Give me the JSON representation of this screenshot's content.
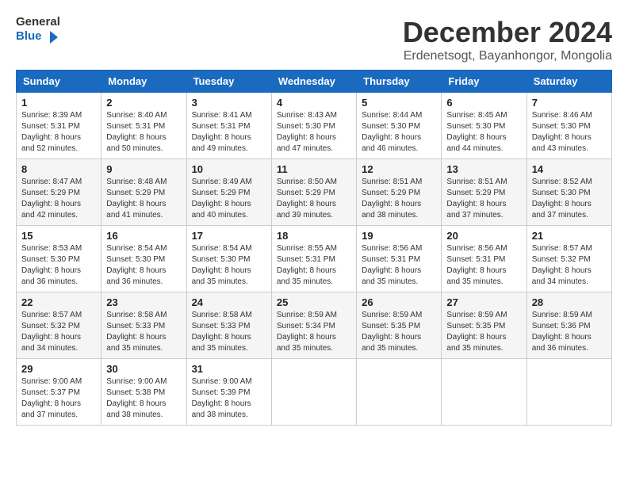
{
  "logo": {
    "line1": "General",
    "line2": "Blue"
  },
  "title": "December 2024",
  "subtitle": "Erdenetsogt, Bayanhongor, Mongolia",
  "header_days": [
    "Sunday",
    "Monday",
    "Tuesday",
    "Wednesday",
    "Thursday",
    "Friday",
    "Saturday"
  ],
  "weeks": [
    [
      {
        "day": "1",
        "sunrise": "Sunrise: 8:39 AM",
        "sunset": "Sunset: 5:31 PM",
        "daylight": "Daylight: 8 hours and 52 minutes."
      },
      {
        "day": "2",
        "sunrise": "Sunrise: 8:40 AM",
        "sunset": "Sunset: 5:31 PM",
        "daylight": "Daylight: 8 hours and 50 minutes."
      },
      {
        "day": "3",
        "sunrise": "Sunrise: 8:41 AM",
        "sunset": "Sunset: 5:31 PM",
        "daylight": "Daylight: 8 hours and 49 minutes."
      },
      {
        "day": "4",
        "sunrise": "Sunrise: 8:43 AM",
        "sunset": "Sunset: 5:30 PM",
        "daylight": "Daylight: 8 hours and 47 minutes."
      },
      {
        "day": "5",
        "sunrise": "Sunrise: 8:44 AM",
        "sunset": "Sunset: 5:30 PM",
        "daylight": "Daylight: 8 hours and 46 minutes."
      },
      {
        "day": "6",
        "sunrise": "Sunrise: 8:45 AM",
        "sunset": "Sunset: 5:30 PM",
        "daylight": "Daylight: 8 hours and 44 minutes."
      },
      {
        "day": "7",
        "sunrise": "Sunrise: 8:46 AM",
        "sunset": "Sunset: 5:30 PM",
        "daylight": "Daylight: 8 hours and 43 minutes."
      }
    ],
    [
      {
        "day": "8",
        "sunrise": "Sunrise: 8:47 AM",
        "sunset": "Sunset: 5:29 PM",
        "daylight": "Daylight: 8 hours and 42 minutes."
      },
      {
        "day": "9",
        "sunrise": "Sunrise: 8:48 AM",
        "sunset": "Sunset: 5:29 PM",
        "daylight": "Daylight: 8 hours and 41 minutes."
      },
      {
        "day": "10",
        "sunrise": "Sunrise: 8:49 AM",
        "sunset": "Sunset: 5:29 PM",
        "daylight": "Daylight: 8 hours and 40 minutes."
      },
      {
        "day": "11",
        "sunrise": "Sunrise: 8:50 AM",
        "sunset": "Sunset: 5:29 PM",
        "daylight": "Daylight: 8 hours and 39 minutes."
      },
      {
        "day": "12",
        "sunrise": "Sunrise: 8:51 AM",
        "sunset": "Sunset: 5:29 PM",
        "daylight": "Daylight: 8 hours and 38 minutes."
      },
      {
        "day": "13",
        "sunrise": "Sunrise: 8:51 AM",
        "sunset": "Sunset: 5:29 PM",
        "daylight": "Daylight: 8 hours and 37 minutes."
      },
      {
        "day": "14",
        "sunrise": "Sunrise: 8:52 AM",
        "sunset": "Sunset: 5:30 PM",
        "daylight": "Daylight: 8 hours and 37 minutes."
      }
    ],
    [
      {
        "day": "15",
        "sunrise": "Sunrise: 8:53 AM",
        "sunset": "Sunset: 5:30 PM",
        "daylight": "Daylight: 8 hours and 36 minutes."
      },
      {
        "day": "16",
        "sunrise": "Sunrise: 8:54 AM",
        "sunset": "Sunset: 5:30 PM",
        "daylight": "Daylight: 8 hours and 36 minutes."
      },
      {
        "day": "17",
        "sunrise": "Sunrise: 8:54 AM",
        "sunset": "Sunset: 5:30 PM",
        "daylight": "Daylight: 8 hours and 35 minutes."
      },
      {
        "day": "18",
        "sunrise": "Sunrise: 8:55 AM",
        "sunset": "Sunset: 5:31 PM",
        "daylight": "Daylight: 8 hours and 35 minutes."
      },
      {
        "day": "19",
        "sunrise": "Sunrise: 8:56 AM",
        "sunset": "Sunset: 5:31 PM",
        "daylight": "Daylight: 8 hours and 35 minutes."
      },
      {
        "day": "20",
        "sunrise": "Sunrise: 8:56 AM",
        "sunset": "Sunset: 5:31 PM",
        "daylight": "Daylight: 8 hours and 35 minutes."
      },
      {
        "day": "21",
        "sunrise": "Sunrise: 8:57 AM",
        "sunset": "Sunset: 5:32 PM",
        "daylight": "Daylight: 8 hours and 34 minutes."
      }
    ],
    [
      {
        "day": "22",
        "sunrise": "Sunrise: 8:57 AM",
        "sunset": "Sunset: 5:32 PM",
        "daylight": "Daylight: 8 hours and 34 minutes."
      },
      {
        "day": "23",
        "sunrise": "Sunrise: 8:58 AM",
        "sunset": "Sunset: 5:33 PM",
        "daylight": "Daylight: 8 hours and 35 minutes."
      },
      {
        "day": "24",
        "sunrise": "Sunrise: 8:58 AM",
        "sunset": "Sunset: 5:33 PM",
        "daylight": "Daylight: 8 hours and 35 minutes."
      },
      {
        "day": "25",
        "sunrise": "Sunrise: 8:59 AM",
        "sunset": "Sunset: 5:34 PM",
        "daylight": "Daylight: 8 hours and 35 minutes."
      },
      {
        "day": "26",
        "sunrise": "Sunrise: 8:59 AM",
        "sunset": "Sunset: 5:35 PM",
        "daylight": "Daylight: 8 hours and 35 minutes."
      },
      {
        "day": "27",
        "sunrise": "Sunrise: 8:59 AM",
        "sunset": "Sunset: 5:35 PM",
        "daylight": "Daylight: 8 hours and 35 minutes."
      },
      {
        "day": "28",
        "sunrise": "Sunrise: 8:59 AM",
        "sunset": "Sunset: 5:36 PM",
        "daylight": "Daylight: 8 hours and 36 minutes."
      }
    ],
    [
      {
        "day": "29",
        "sunrise": "Sunrise: 9:00 AM",
        "sunset": "Sunset: 5:37 PM",
        "daylight": "Daylight: 8 hours and 37 minutes."
      },
      {
        "day": "30",
        "sunrise": "Sunrise: 9:00 AM",
        "sunset": "Sunset: 5:38 PM",
        "daylight": "Daylight: 8 hours and 38 minutes."
      },
      {
        "day": "31",
        "sunrise": "Sunrise: 9:00 AM",
        "sunset": "Sunset: 5:39 PM",
        "daylight": "Daylight: 8 hours and 38 minutes."
      },
      null,
      null,
      null,
      null
    ]
  ]
}
